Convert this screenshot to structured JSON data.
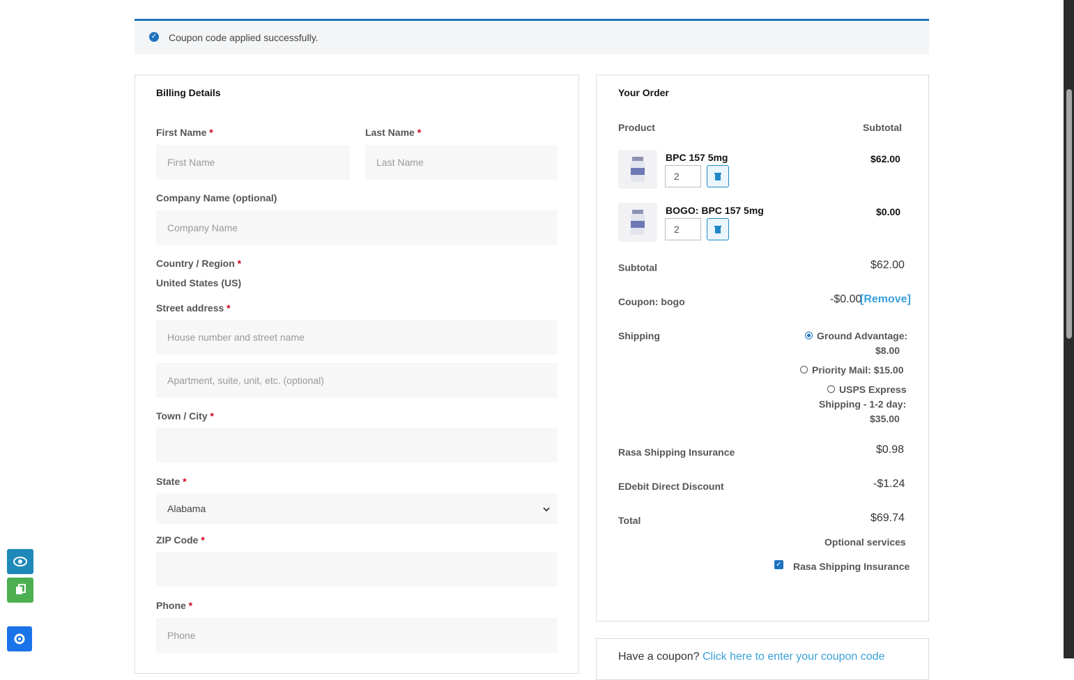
{
  "notice": {
    "message": "Coupon code applied successfully."
  },
  "billing": {
    "title": "Billing Details",
    "first_name": {
      "label": "First Name",
      "placeholder": "First Name"
    },
    "last_name": {
      "label": "Last Name",
      "placeholder": "Last Name"
    },
    "company": {
      "label": "Company Name (optional)",
      "placeholder": "Company Name"
    },
    "country": {
      "label": "Country / Region",
      "value": "United States (US)"
    },
    "street": {
      "label": "Street address",
      "placeholder1": "House number and street name",
      "placeholder2": "Apartment, suite, unit, etc. (optional)"
    },
    "city": {
      "label": "Town / City"
    },
    "state": {
      "label": "State",
      "value": "Alabama"
    },
    "zip": {
      "label": "ZIP Code"
    },
    "phone": {
      "label": "Phone",
      "placeholder": "Phone"
    },
    "required_mark": "*"
  },
  "order": {
    "title": "Your Order",
    "col_product": "Product",
    "col_subtotal": "Subtotal",
    "items": [
      {
        "name": "BPC 157 5mg",
        "qty": "2",
        "price": "$62.00"
      },
      {
        "name": "BOGO: BPC 157 5mg",
        "qty": "2",
        "price": "$0.00"
      }
    ],
    "subtotal_label": "Subtotal",
    "subtotal_value": "$62.00",
    "coupon_label": "Coupon: bogo",
    "coupon_value": "-$0.00",
    "coupon_remove": "[Remove]",
    "shipping_label": "Shipping",
    "shipping_options": {
      "ground_name": "Ground Advantage:",
      "ground_price": "$8.00",
      "priority_name": "Priority Mail:",
      "priority_price": "$15.00",
      "usps_line1": "USPS Express",
      "usps_line2": "Shipping - 1-2 day:",
      "usps_price": "$35.00"
    },
    "insurance_label": "Rasa Shipping Insurance",
    "insurance_value": "$0.98",
    "discount_label": "EDebit Direct Discount",
    "discount_value": "-$1.24",
    "total_label": "Total",
    "total_value": "$69.74",
    "optional_services_label": "Optional services",
    "optional_insurance_label": "Rasa Shipping Insurance"
  },
  "coupon_prompt": {
    "text": "Have a coupon?",
    "link": "Click here to enter your coupon code"
  },
  "colors": {
    "accent": "#1e73be",
    "link": "#3aa0d8",
    "required": "#d0021b",
    "float_blue": "#1e88b8",
    "float_green": "#4caf50"
  },
  "icons": {
    "notice": "check-circle-icon",
    "trash": "trash-icon",
    "eye": "eye-icon",
    "copy": "copy-icon",
    "gear": "gear-icon",
    "chevron": "chevron-down-icon"
  }
}
